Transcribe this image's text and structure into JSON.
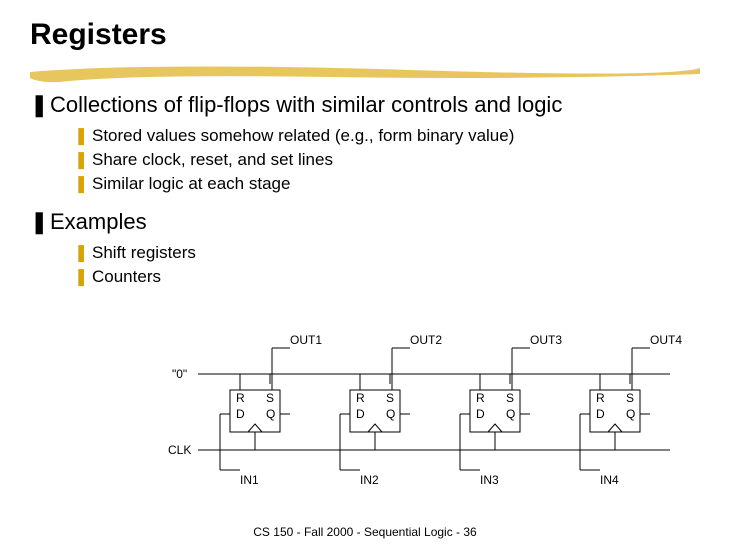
{
  "title": "Registers",
  "bullets": {
    "main1": "Collections of flip-flops with similar controls and logic",
    "sub1a": "Stored values somehow related (e.g., form binary value)",
    "sub1b": "Share clock, reset, and set lines",
    "sub1c": "Similar logic at each stage",
    "main2": "Examples",
    "sub2a": "Shift registers",
    "sub2b": "Counters"
  },
  "diagram": {
    "outs": [
      "OUT1",
      "OUT2",
      "OUT3",
      "OUT4"
    ],
    "ins": [
      "IN1",
      "IN2",
      "IN3",
      "IN4"
    ],
    "zero": "\"0\"",
    "clk": "CLK",
    "pins": {
      "R": "R",
      "S": "S",
      "D": "D",
      "Q": "Q"
    }
  },
  "footer": "CS 150 - Fall  2000 - Sequential Logic - 36"
}
